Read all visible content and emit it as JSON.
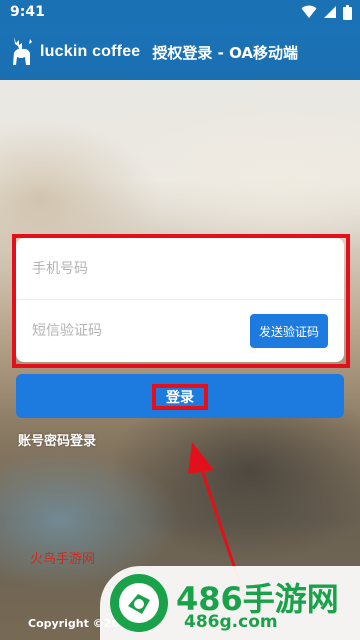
{
  "status_bar": {
    "time": "9:41"
  },
  "header": {
    "brand": "luckin coffee",
    "title": "授权登录 - OA移动端"
  },
  "login_form": {
    "phone_placeholder": "手机号码",
    "sms_placeholder": "短信验证码",
    "send_code_label": "发送验证码",
    "login_label": "登录",
    "password_login_label": "账号密码登录"
  },
  "footer": {
    "copyright": "Copyright ©20"
  },
  "watermarks": {
    "text": "火鸟手游网",
    "site_name": "486手游网",
    "site_domain": "486g.com"
  },
  "colors": {
    "header_blue": "#1a71b4",
    "button_blue": "#1d7be0",
    "highlight_red": "#e3101b",
    "site_green": "#1aa24a"
  },
  "icons": [
    "wifi-icon",
    "cellular-signal-icon",
    "battery-icon",
    "deer-logo-icon",
    "site-logo-icon",
    "arrow-annotation-icon"
  ]
}
